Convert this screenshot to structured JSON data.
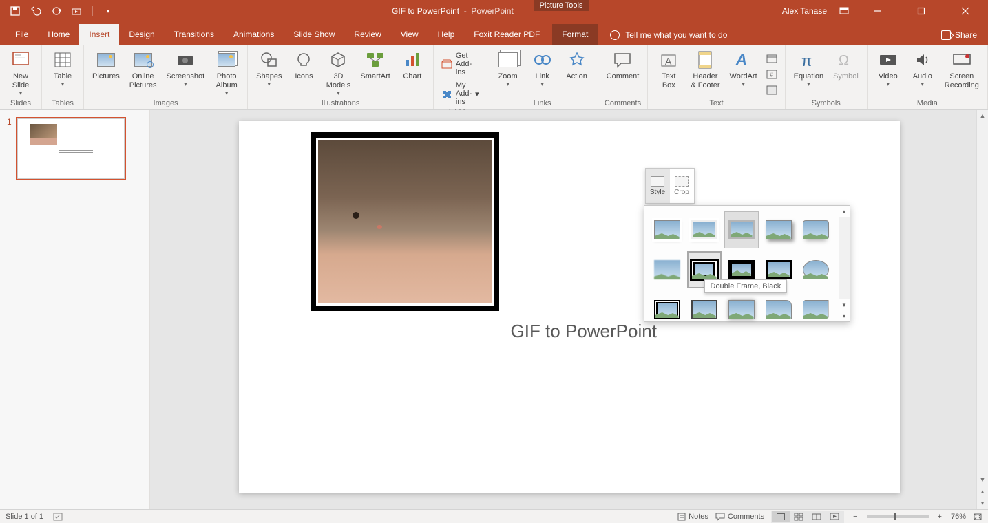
{
  "titlebar": {
    "doc_name": "GIF to PowerPoint",
    "app_name": "PowerPoint",
    "contextual_tool": "Picture Tools",
    "user_name": "Alex Tanase"
  },
  "tabs": {
    "file": "File",
    "home": "Home",
    "insert": "Insert",
    "design": "Design",
    "transitions": "Transitions",
    "animations": "Animations",
    "slideshow": "Slide Show",
    "review": "Review",
    "view": "View",
    "help": "Help",
    "foxit": "Foxit Reader PDF",
    "format": "Format",
    "tellme": "Tell me what you want to do",
    "share": "Share"
  },
  "ribbon": {
    "slides": {
      "new_slide": "New\nSlide",
      "label": "Slides"
    },
    "tables": {
      "table": "Table",
      "label": "Tables"
    },
    "images": {
      "pictures": "Pictures",
      "online_pictures": "Online\nPictures",
      "screenshot": "Screenshot",
      "photo_album": "Photo\nAlbum",
      "label": "Images"
    },
    "illustrations": {
      "shapes": "Shapes",
      "icons": "Icons",
      "models": "3D\nModels",
      "smartart": "SmartArt",
      "chart": "Chart",
      "label": "Illustrations"
    },
    "addins": {
      "get": "Get Add-ins",
      "my": "My Add-ins",
      "label": "Add-ins"
    },
    "links": {
      "zoom": "Zoom",
      "link": "Link",
      "action": "Action",
      "label": "Links"
    },
    "comments": {
      "comment": "Comment",
      "label": "Comments"
    },
    "text": {
      "textbox": "Text\nBox",
      "headerfooter": "Header\n& Footer",
      "wordart": "WordArt",
      "label": "Text"
    },
    "symbols": {
      "equation": "Equation",
      "symbol": "Symbol",
      "label": "Symbols"
    },
    "media": {
      "video": "Video",
      "audio": "Audio",
      "screenrec": "Screen\nRecording",
      "label": "Media"
    }
  },
  "thumbnails": {
    "slide1_num": "1"
  },
  "slide": {
    "title_text": "GIF to PowerPoint"
  },
  "mini_toolbar": {
    "style": "Style",
    "crop": "Crop"
  },
  "gallery": {
    "tooltip": "Double Frame, Black"
  },
  "statusbar": {
    "slide_info": "Slide 1 of 1",
    "notes": "Notes",
    "comments": "Comments",
    "zoom": "76%"
  }
}
